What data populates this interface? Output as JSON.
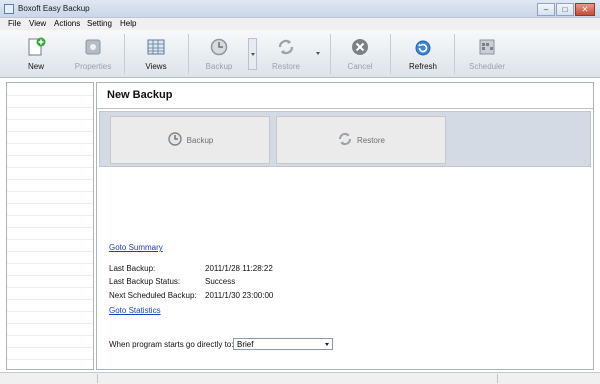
{
  "window": {
    "title": "Boxoft Easy Backup"
  },
  "menu": [
    "File",
    "View",
    "Actions",
    "Setting",
    "Help"
  ],
  "toolbar": {
    "new": "New",
    "properties": "Properties",
    "views": "Views",
    "backup": "Backup",
    "restore": "Restore",
    "cancel": "Cancel",
    "refresh": "Refresh",
    "scheduler": "Scheduler"
  },
  "main": {
    "title": "New Backup",
    "backup_button": "Backup",
    "restore_button": "Restore",
    "goto_summary": "Goto Summary",
    "last_backup_label": "Last Backup:",
    "last_backup_value": "2011/1/28 11:28:22",
    "last_status_label": "Last Backup Status:",
    "last_status_value": "Success",
    "next_backup_label": "Next Scheduled Backup:",
    "next_backup_value": "2011/1/30 23:00:00",
    "goto_statistics": "Goto Statistics",
    "startup_label": "When program starts go directly to:",
    "startup_value": "Brief"
  },
  "colors": {
    "accent": "#1a3fb0",
    "toolbar_bg": "#e6ebf0",
    "action_strip": "#d3dae3"
  }
}
